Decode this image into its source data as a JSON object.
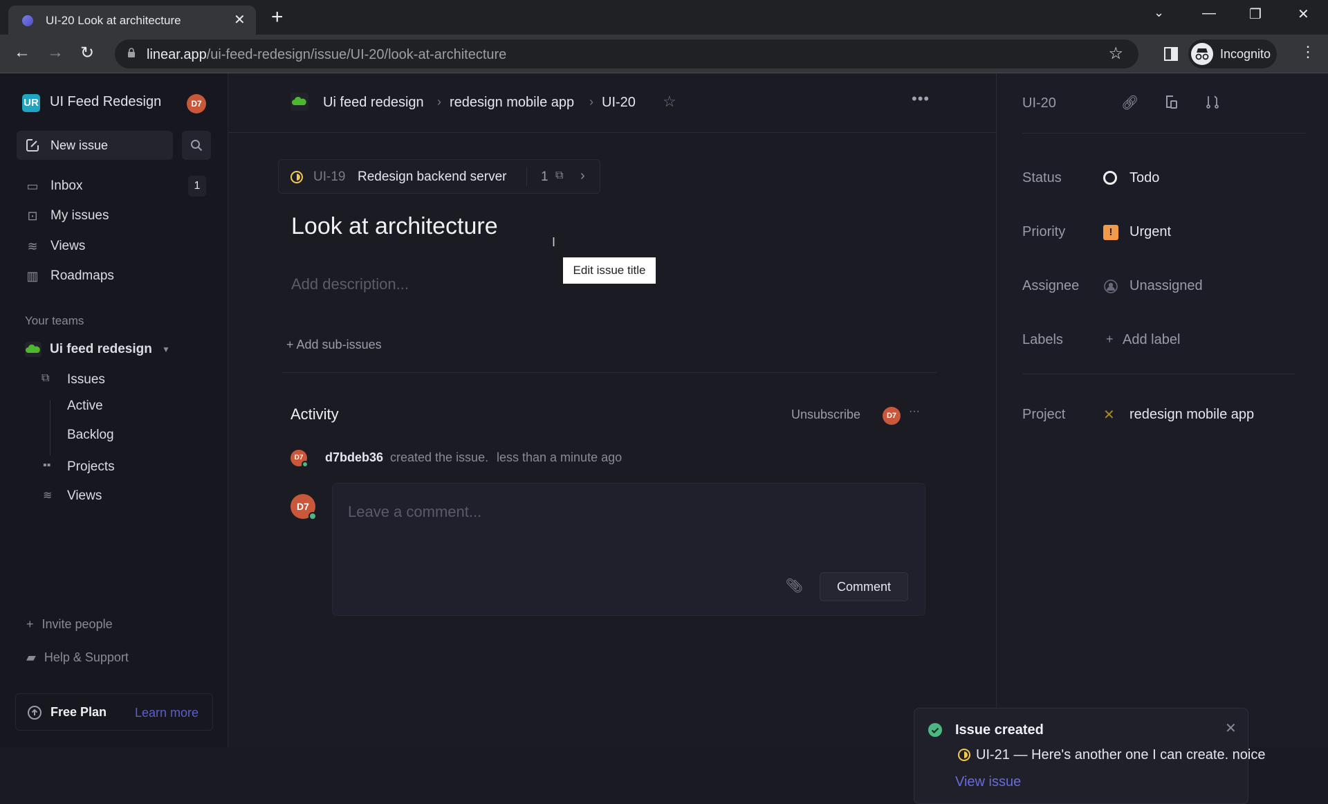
{
  "browser": {
    "tab_title": "UI-20 Look at architecture",
    "url_host": "linear.app",
    "url_path": "/ui-feed-redesign/issue/UI-20/look-at-architecture",
    "profile_label": "Incognito"
  },
  "sidebar": {
    "workspace_initials": "UR",
    "workspace_name": "UI Feed Redesign",
    "user_initials": "D7",
    "new_issue_label": "New issue",
    "items": [
      {
        "label": "Inbox",
        "icon": "inbox-icon",
        "badge": "1"
      },
      {
        "label": "My issues",
        "icon": "my-issues-icon"
      },
      {
        "label": "Views",
        "icon": "layers-icon"
      },
      {
        "label": "Roadmaps",
        "icon": "map-icon"
      }
    ],
    "teams_label": "Your teams",
    "team": {
      "name": "Ui feed redesign",
      "items": [
        {
          "label": "Issues"
        },
        {
          "label": "Active"
        },
        {
          "label": "Backlog"
        },
        {
          "label": "Projects"
        },
        {
          "label": "Views"
        }
      ]
    },
    "invite_label": "Invite people",
    "help_label": "Help & Support",
    "plan_label": "Free Plan",
    "learn_more_label": "Learn more"
  },
  "main": {
    "breadcrumb": [
      "Ui feed redesign",
      "redesign mobile app",
      "UI-20"
    ],
    "parent_issue": {
      "id": "UI-19",
      "title": "Redesign backend server",
      "sub_count": "1"
    },
    "title": "Look at architecture",
    "description_placeholder": "Add description...",
    "tooltip": "Edit issue title",
    "add_sub_issues": "+ Add sub-issues",
    "activity": {
      "heading": "Activity",
      "unsubscribe_label": "Unsubscribe",
      "subscriber_initials": "D7",
      "entries": [
        {
          "user": "d7bdeb36",
          "action": "created the issue.",
          "time": "less than a minute ago",
          "initials": "D7"
        }
      ],
      "comment_placeholder": "Leave a comment...",
      "comment_button": "Comment",
      "commenter_initials": "D7"
    }
  },
  "details": {
    "issue_id": "UI-20",
    "properties": [
      {
        "label": "Status",
        "value": "Todo"
      },
      {
        "label": "Priority",
        "value": "Urgent"
      },
      {
        "label": "Assignee",
        "value": "Unassigned"
      },
      {
        "label": "Labels",
        "value": "Add label"
      },
      {
        "label": "Project",
        "value": "redesign mobile app"
      }
    ]
  },
  "toast": {
    "title": "Issue created",
    "issue_id": "UI-21",
    "message": "Here's another one I can create. noice",
    "separator": "—",
    "action": "View issue"
  },
  "colors": {
    "accent": "#5e6ad2",
    "urgent": "#f2994a",
    "success": "#4cb782",
    "in_progress": "#f2c94c",
    "team_green": "#4fb62f"
  }
}
